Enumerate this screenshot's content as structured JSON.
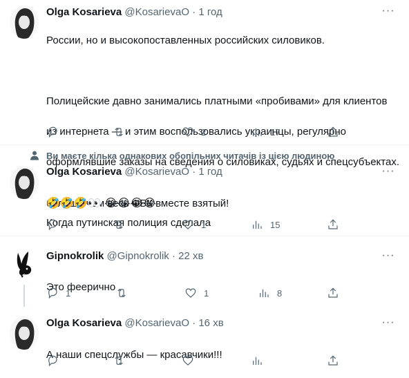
{
  "tweets": [
    {
      "name": "Olga Kosarieva",
      "handle": "@KosarievaO",
      "dot": "·",
      "time": "1 год",
      "lines": [
        "России, но и высокопоставленных российских силовиков.",
        "",
        "Полицейские давно занимались платными «пробивами» для клиентов",
        "из интернета — и этим воспользовались украинцы, регулярно",
        "оформлявшие заказы на сведения о силовиках, судьях и спецсубъектах.",
        "",
        "Когда путинская полиция сделала"
      ],
      "replies": "",
      "retweets": "",
      "likes": "2",
      "views": "17"
    },
    {
      "social_context": "Ви маєте кілька однакових обопільних читачів із цією людиною",
      "name": "Olga Kosarieva",
      "handle": "@KosarievaO",
      "dot": "·",
      "time": "1 год",
      "lines": [
        "больше чем весь ФБК вместе взятый!"
      ],
      "emoji_line": "🤣🤣🤣👀 😂😂😂😂",
      "replies": "",
      "retweets": "",
      "likes": "1",
      "views": "15"
    },
    {
      "name": "Gipnokrolik",
      "handle": "@Gipnokrolik",
      "dot": "·",
      "time": "22 хв",
      "lines": [
        "Это феерично"
      ],
      "replies": "1",
      "retweets": "",
      "likes": "1",
      "views": "8"
    },
    {
      "name": "Olga Kosarieva",
      "handle": "@KosarievaO",
      "dot": "·",
      "time": "16 хв",
      "lines": [
        "А наши спецслужбы — красавчики!!!"
      ],
      "replies": "",
      "retweets": "",
      "likes": "",
      "views": ""
    }
  ],
  "colors": {
    "text": "#0f1419",
    "secondary": "#536471",
    "divider": "#eff3f4",
    "thread_line": "#cfd9de"
  },
  "icons": {
    "reply": "reply-icon",
    "retweet": "retweet-icon",
    "like": "heart-icon",
    "views": "views-icon",
    "share": "share-icon",
    "more": "more-icon",
    "social": "person-icon"
  },
  "more_label": "···"
}
